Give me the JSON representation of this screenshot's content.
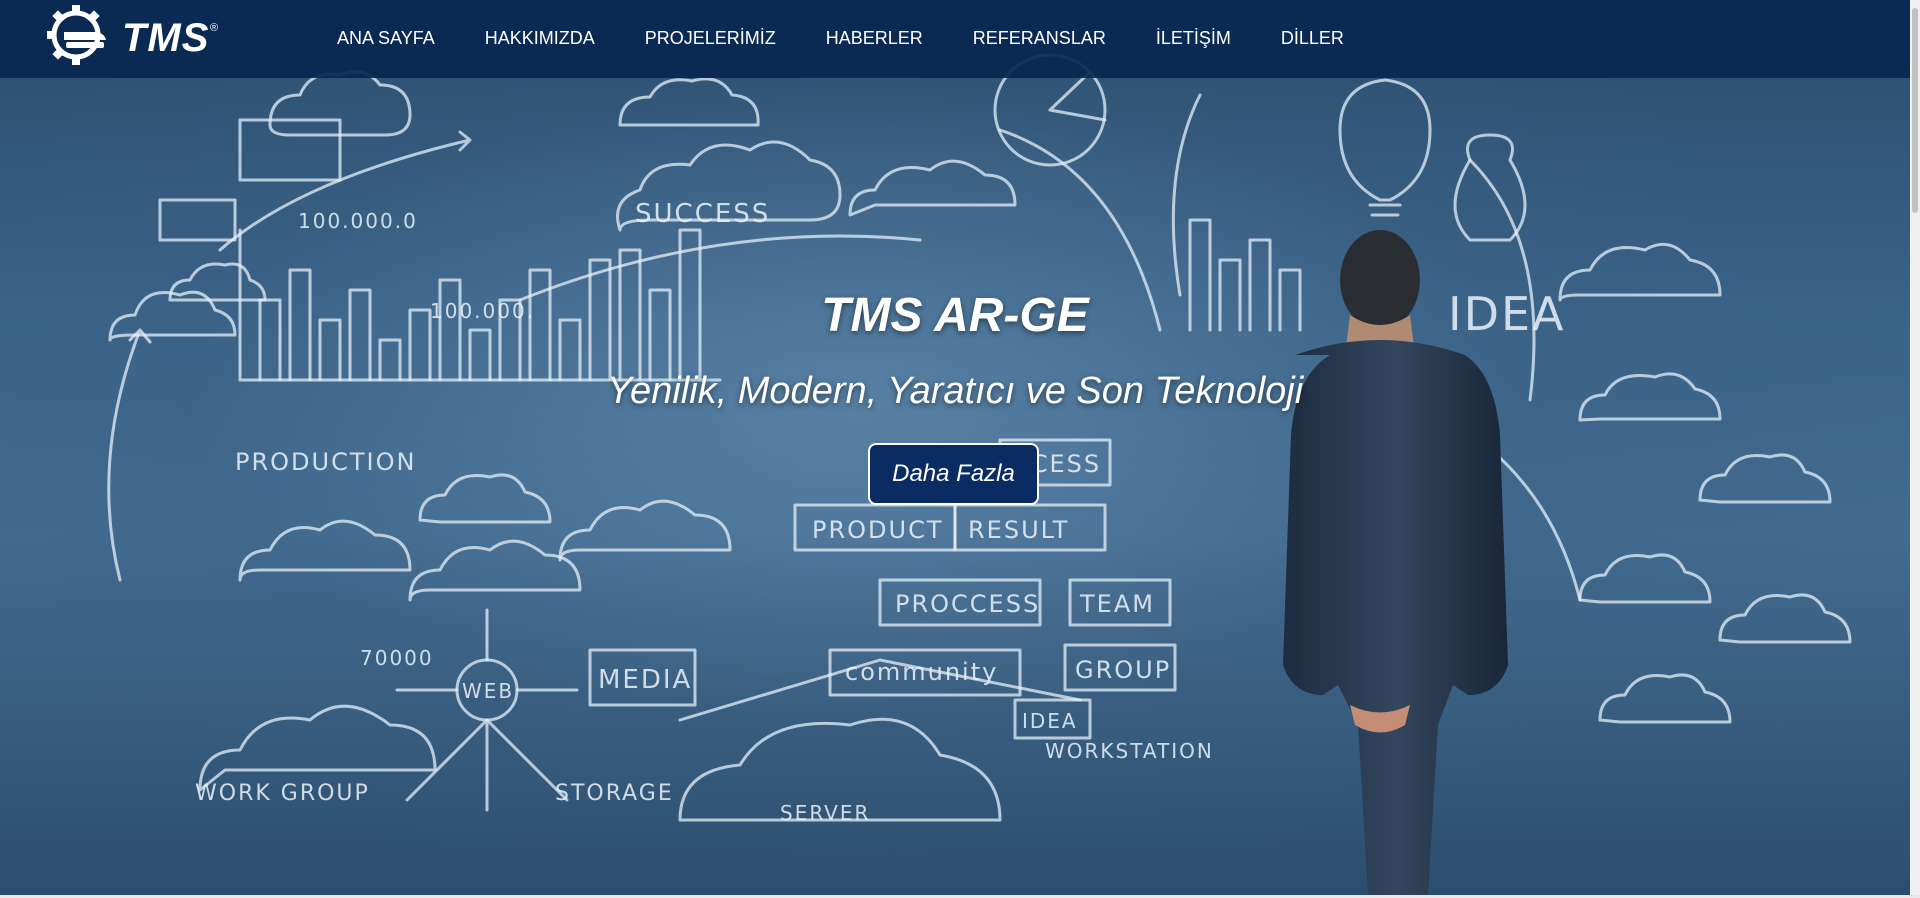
{
  "brand": {
    "logo_text": "TMS",
    "registered_mark": "®"
  },
  "nav": {
    "items": [
      {
        "label": "ANA SAYFA"
      },
      {
        "label": "HAKKIMIZDA"
      },
      {
        "label": "PROJELERİMİZ"
      },
      {
        "label": "HABERLER"
      },
      {
        "label": "REFERANSLAR"
      },
      {
        "label": "İLETİŞİM"
      },
      {
        "label": "DİLLER"
      }
    ]
  },
  "hero": {
    "title": "TMS AR-GE",
    "subtitle": "Yenilik, Modern, Yaratıcı ve Son Teknoloji",
    "cta_label": "Daha Fazla",
    "sketch_words": {
      "success": "SUCCESS",
      "n1": "100.000.0",
      "n2": "100.000.",
      "production": "PRODUCTION",
      "product": "PRODUCT",
      "result": "RESULT",
      "process": "PROCCESS",
      "team": "TEAM",
      "community": "community",
      "group": "GROUP",
      "media": "MEDIA",
      "web": "WEB",
      "idea_box": "IDEA",
      "workstation": "WORKSTATION",
      "n3": "70000",
      "workgroup": "WORK GROUP",
      "storage": "STORAGE",
      "server": "SERVER",
      "idea_big": "IDEA",
      "success_small": "CCESS"
    }
  },
  "colors": {
    "header_bg": "#08265A",
    "cta_bg": "#0B2C63",
    "text": "#FFFFFF"
  }
}
